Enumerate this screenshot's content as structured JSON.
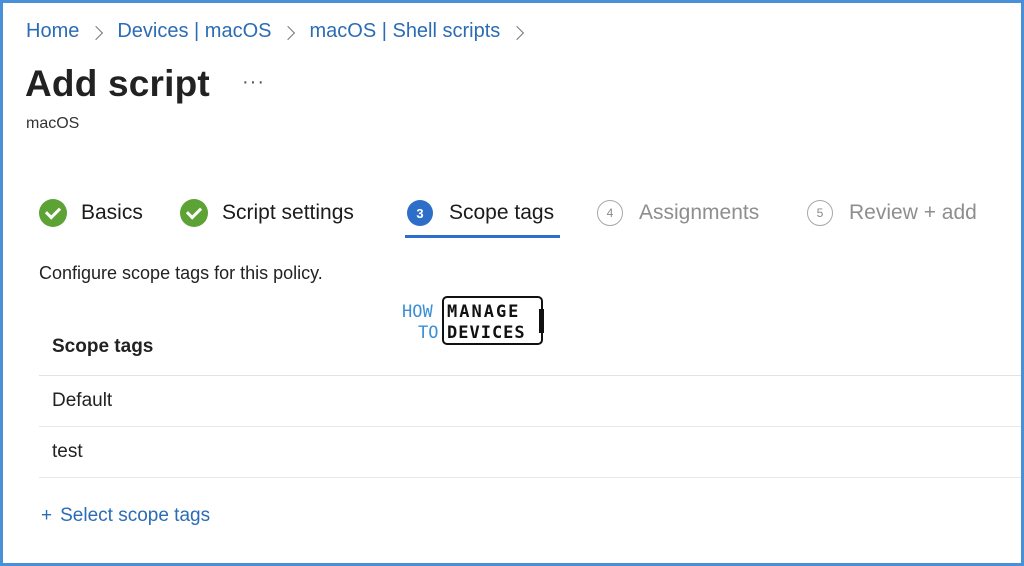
{
  "breadcrumb": [
    "Home",
    "Devices | macOS",
    "macOS | Shell scripts"
  ],
  "header": {
    "title": "Add script",
    "more": "···",
    "subtitle": "macOS"
  },
  "steps": [
    {
      "label": "Basics",
      "state": "completed"
    },
    {
      "label": "Script settings",
      "state": "completed"
    },
    {
      "number": "3",
      "label": "Scope tags",
      "state": "active"
    },
    {
      "number": "4",
      "label": "Assignments",
      "state": "inactive"
    },
    {
      "number": "5",
      "label": "Review + add",
      "state": "inactive"
    }
  ],
  "main": {
    "description": "Configure scope tags for this policy.",
    "table": {
      "header": "Scope tags",
      "rows": [
        "Default",
        "test"
      ]
    },
    "select_link": "Select scope tags",
    "select_link_icon": "plus-icon"
  },
  "watermark": {
    "line1a": "HOW",
    "line1b": "MANAGE",
    "line2a": "TO",
    "line2b": "DEVICES"
  },
  "colors": {
    "accent": "#2d6ec9",
    "link": "#2b6cb5",
    "success": "#5ca234",
    "frame": "#4a90d9"
  }
}
